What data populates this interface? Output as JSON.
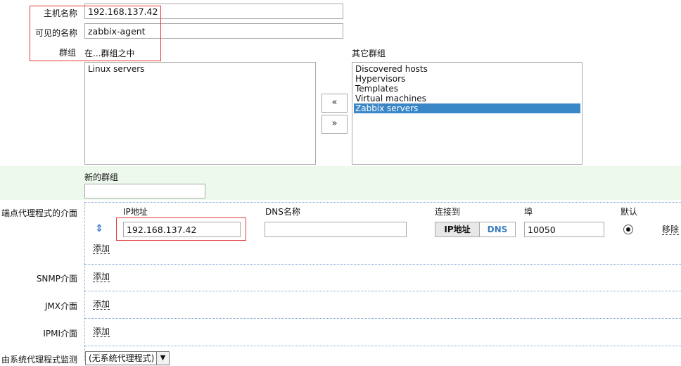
{
  "host": {
    "hostname_label": "主机名称",
    "hostname_value": "192.168.137.42",
    "visible_name_label": "可见的名称",
    "visible_name_value": "zabbix-agent",
    "groups_label": "群组",
    "in_groups_label": "在...群组之中",
    "other_groups_label": "其它群组",
    "in_groups": [
      "Linux servers"
    ],
    "other_groups": [
      "Discovered hosts",
      "Hypervisors",
      "Templates",
      "Virtual machines",
      "Zabbix servers"
    ],
    "other_groups_selected": "Zabbix servers",
    "move_left": "«",
    "move_right": "»",
    "new_group_label": "新的群组",
    "new_group_value": ""
  },
  "agent_interfaces": {
    "section_label": "端点代理程式的介面",
    "col_ip": "IP地址",
    "col_dns": "DNS名称",
    "col_connect": "连接到",
    "col_port": "埠",
    "col_default": "默认",
    "move_icon": "⇕",
    "rows": [
      {
        "ip": "192.168.137.42",
        "dns": "",
        "connect_ip": "IP地址",
        "connect_dns": "DNS",
        "connect_selected": "IP",
        "port": "10050",
        "default": true,
        "remove": "移除"
      }
    ],
    "add_label": "添加"
  },
  "snmp": {
    "label": "SNMP介面",
    "add": "添加"
  },
  "jmx": {
    "label": "JMX介面",
    "add": "添加"
  },
  "ipmi": {
    "label": "IPMI介面",
    "add": "添加"
  },
  "proxy": {
    "label": "由系统代理程式监测",
    "selected": "(无系统代理程式)"
  },
  "colors": {
    "accent": "#3a87c8",
    "highlight_box": "#e03a3a",
    "band": "#eef9ee"
  }
}
